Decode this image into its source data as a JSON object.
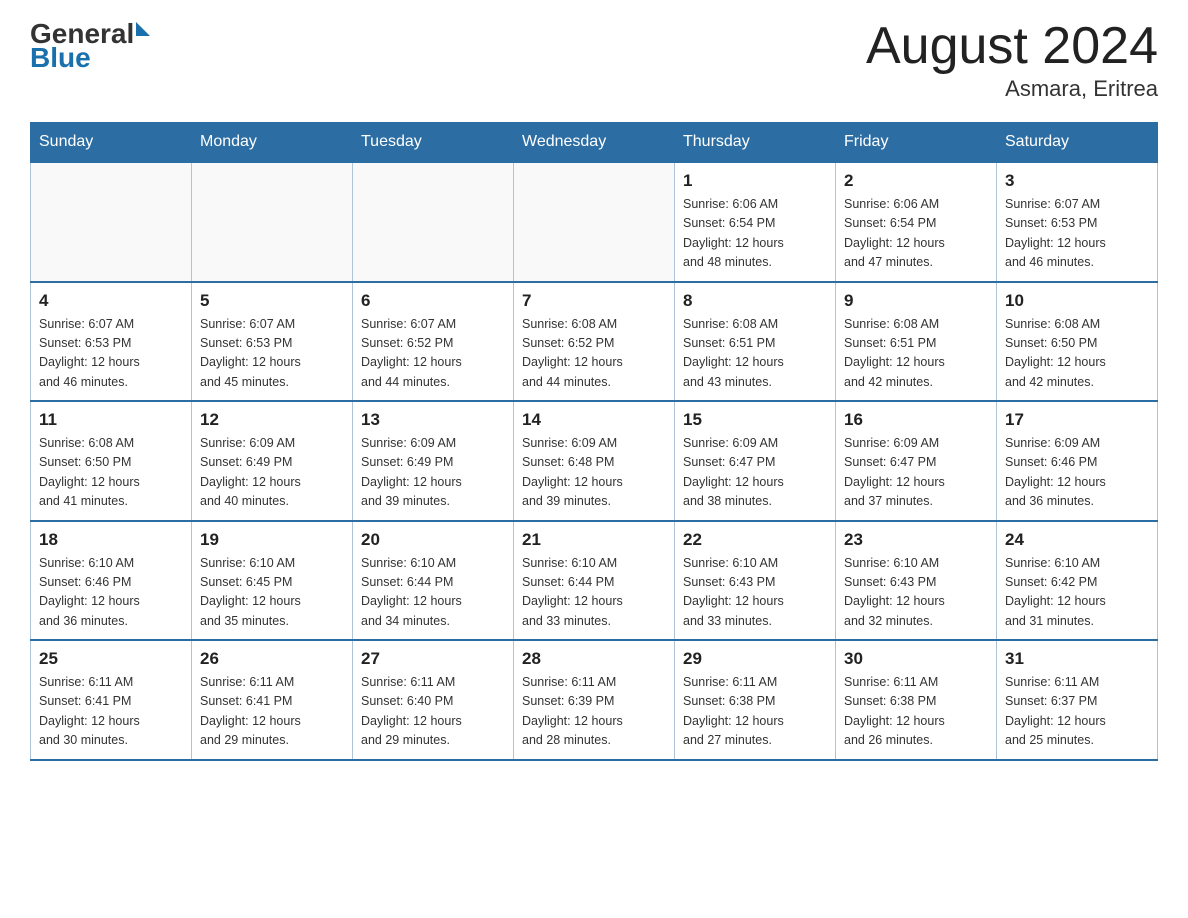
{
  "header": {
    "logo_text1": "General",
    "logo_text2": "Blue",
    "month": "August 2024",
    "location": "Asmara, Eritrea"
  },
  "days_of_week": [
    "Sunday",
    "Monday",
    "Tuesday",
    "Wednesday",
    "Thursday",
    "Friday",
    "Saturday"
  ],
  "weeks": [
    [
      {
        "day": "",
        "info": ""
      },
      {
        "day": "",
        "info": ""
      },
      {
        "day": "",
        "info": ""
      },
      {
        "day": "",
        "info": ""
      },
      {
        "day": "1",
        "info": "Sunrise: 6:06 AM\nSunset: 6:54 PM\nDaylight: 12 hours\nand 48 minutes."
      },
      {
        "day": "2",
        "info": "Sunrise: 6:06 AM\nSunset: 6:54 PM\nDaylight: 12 hours\nand 47 minutes."
      },
      {
        "day": "3",
        "info": "Sunrise: 6:07 AM\nSunset: 6:53 PM\nDaylight: 12 hours\nand 46 minutes."
      }
    ],
    [
      {
        "day": "4",
        "info": "Sunrise: 6:07 AM\nSunset: 6:53 PM\nDaylight: 12 hours\nand 46 minutes."
      },
      {
        "day": "5",
        "info": "Sunrise: 6:07 AM\nSunset: 6:53 PM\nDaylight: 12 hours\nand 45 minutes."
      },
      {
        "day": "6",
        "info": "Sunrise: 6:07 AM\nSunset: 6:52 PM\nDaylight: 12 hours\nand 44 minutes."
      },
      {
        "day": "7",
        "info": "Sunrise: 6:08 AM\nSunset: 6:52 PM\nDaylight: 12 hours\nand 44 minutes."
      },
      {
        "day": "8",
        "info": "Sunrise: 6:08 AM\nSunset: 6:51 PM\nDaylight: 12 hours\nand 43 minutes."
      },
      {
        "day": "9",
        "info": "Sunrise: 6:08 AM\nSunset: 6:51 PM\nDaylight: 12 hours\nand 42 minutes."
      },
      {
        "day": "10",
        "info": "Sunrise: 6:08 AM\nSunset: 6:50 PM\nDaylight: 12 hours\nand 42 minutes."
      }
    ],
    [
      {
        "day": "11",
        "info": "Sunrise: 6:08 AM\nSunset: 6:50 PM\nDaylight: 12 hours\nand 41 minutes."
      },
      {
        "day": "12",
        "info": "Sunrise: 6:09 AM\nSunset: 6:49 PM\nDaylight: 12 hours\nand 40 minutes."
      },
      {
        "day": "13",
        "info": "Sunrise: 6:09 AM\nSunset: 6:49 PM\nDaylight: 12 hours\nand 39 minutes."
      },
      {
        "day": "14",
        "info": "Sunrise: 6:09 AM\nSunset: 6:48 PM\nDaylight: 12 hours\nand 39 minutes."
      },
      {
        "day": "15",
        "info": "Sunrise: 6:09 AM\nSunset: 6:47 PM\nDaylight: 12 hours\nand 38 minutes."
      },
      {
        "day": "16",
        "info": "Sunrise: 6:09 AM\nSunset: 6:47 PM\nDaylight: 12 hours\nand 37 minutes."
      },
      {
        "day": "17",
        "info": "Sunrise: 6:09 AM\nSunset: 6:46 PM\nDaylight: 12 hours\nand 36 minutes."
      }
    ],
    [
      {
        "day": "18",
        "info": "Sunrise: 6:10 AM\nSunset: 6:46 PM\nDaylight: 12 hours\nand 36 minutes."
      },
      {
        "day": "19",
        "info": "Sunrise: 6:10 AM\nSunset: 6:45 PM\nDaylight: 12 hours\nand 35 minutes."
      },
      {
        "day": "20",
        "info": "Sunrise: 6:10 AM\nSunset: 6:44 PM\nDaylight: 12 hours\nand 34 minutes."
      },
      {
        "day": "21",
        "info": "Sunrise: 6:10 AM\nSunset: 6:44 PM\nDaylight: 12 hours\nand 33 minutes."
      },
      {
        "day": "22",
        "info": "Sunrise: 6:10 AM\nSunset: 6:43 PM\nDaylight: 12 hours\nand 33 minutes."
      },
      {
        "day": "23",
        "info": "Sunrise: 6:10 AM\nSunset: 6:43 PM\nDaylight: 12 hours\nand 32 minutes."
      },
      {
        "day": "24",
        "info": "Sunrise: 6:10 AM\nSunset: 6:42 PM\nDaylight: 12 hours\nand 31 minutes."
      }
    ],
    [
      {
        "day": "25",
        "info": "Sunrise: 6:11 AM\nSunset: 6:41 PM\nDaylight: 12 hours\nand 30 minutes."
      },
      {
        "day": "26",
        "info": "Sunrise: 6:11 AM\nSunset: 6:41 PM\nDaylight: 12 hours\nand 29 minutes."
      },
      {
        "day": "27",
        "info": "Sunrise: 6:11 AM\nSunset: 6:40 PM\nDaylight: 12 hours\nand 29 minutes."
      },
      {
        "day": "28",
        "info": "Sunrise: 6:11 AM\nSunset: 6:39 PM\nDaylight: 12 hours\nand 28 minutes."
      },
      {
        "day": "29",
        "info": "Sunrise: 6:11 AM\nSunset: 6:38 PM\nDaylight: 12 hours\nand 27 minutes."
      },
      {
        "day": "30",
        "info": "Sunrise: 6:11 AM\nSunset: 6:38 PM\nDaylight: 12 hours\nand 26 minutes."
      },
      {
        "day": "31",
        "info": "Sunrise: 6:11 AM\nSunset: 6:37 PM\nDaylight: 12 hours\nand 25 minutes."
      }
    ]
  ]
}
